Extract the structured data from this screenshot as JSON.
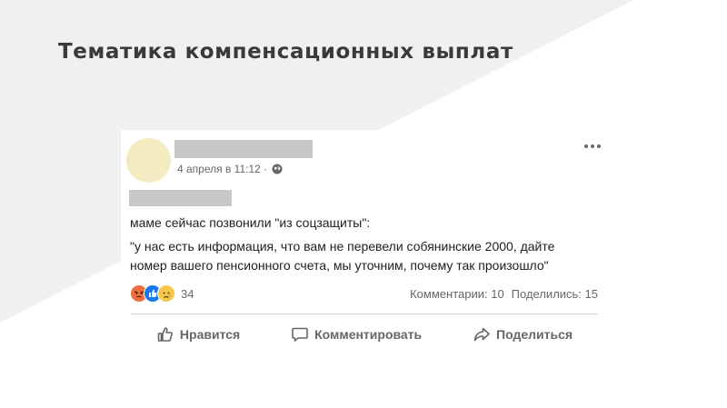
{
  "slide": {
    "title": "Тематика компенсационных выплат"
  },
  "post": {
    "timestamp": "4 апреля в 11:12 ·",
    "visibility_icon": "globe-icon",
    "more_icon": "more-dots-icon",
    "body": {
      "line1": "маме сейчас позвонили \"из соцзащиты\":",
      "line2": "\"у нас есть информация, что вам не перевели собянинские 2000, дайте",
      "line3": "номер вашего пенсионного счета, мы уточним, почему так произошло\""
    },
    "reactions": {
      "icons": [
        "angry-reaction-icon",
        "like-reaction-icon",
        "sad-reaction-icon"
      ],
      "count": "34"
    },
    "stats": {
      "comments": "Комментарии: 10",
      "shares": "Поделились: 15"
    },
    "actions": {
      "like": "Нравится",
      "comment": "Комментировать",
      "share": "Поделиться"
    }
  },
  "colors": {
    "background_shape": "#f0f0f0",
    "title": "#3a3a3a",
    "secondary_text": "#65676b",
    "redaction": "#c8c8c8",
    "avatar": "#f3ebc2"
  }
}
